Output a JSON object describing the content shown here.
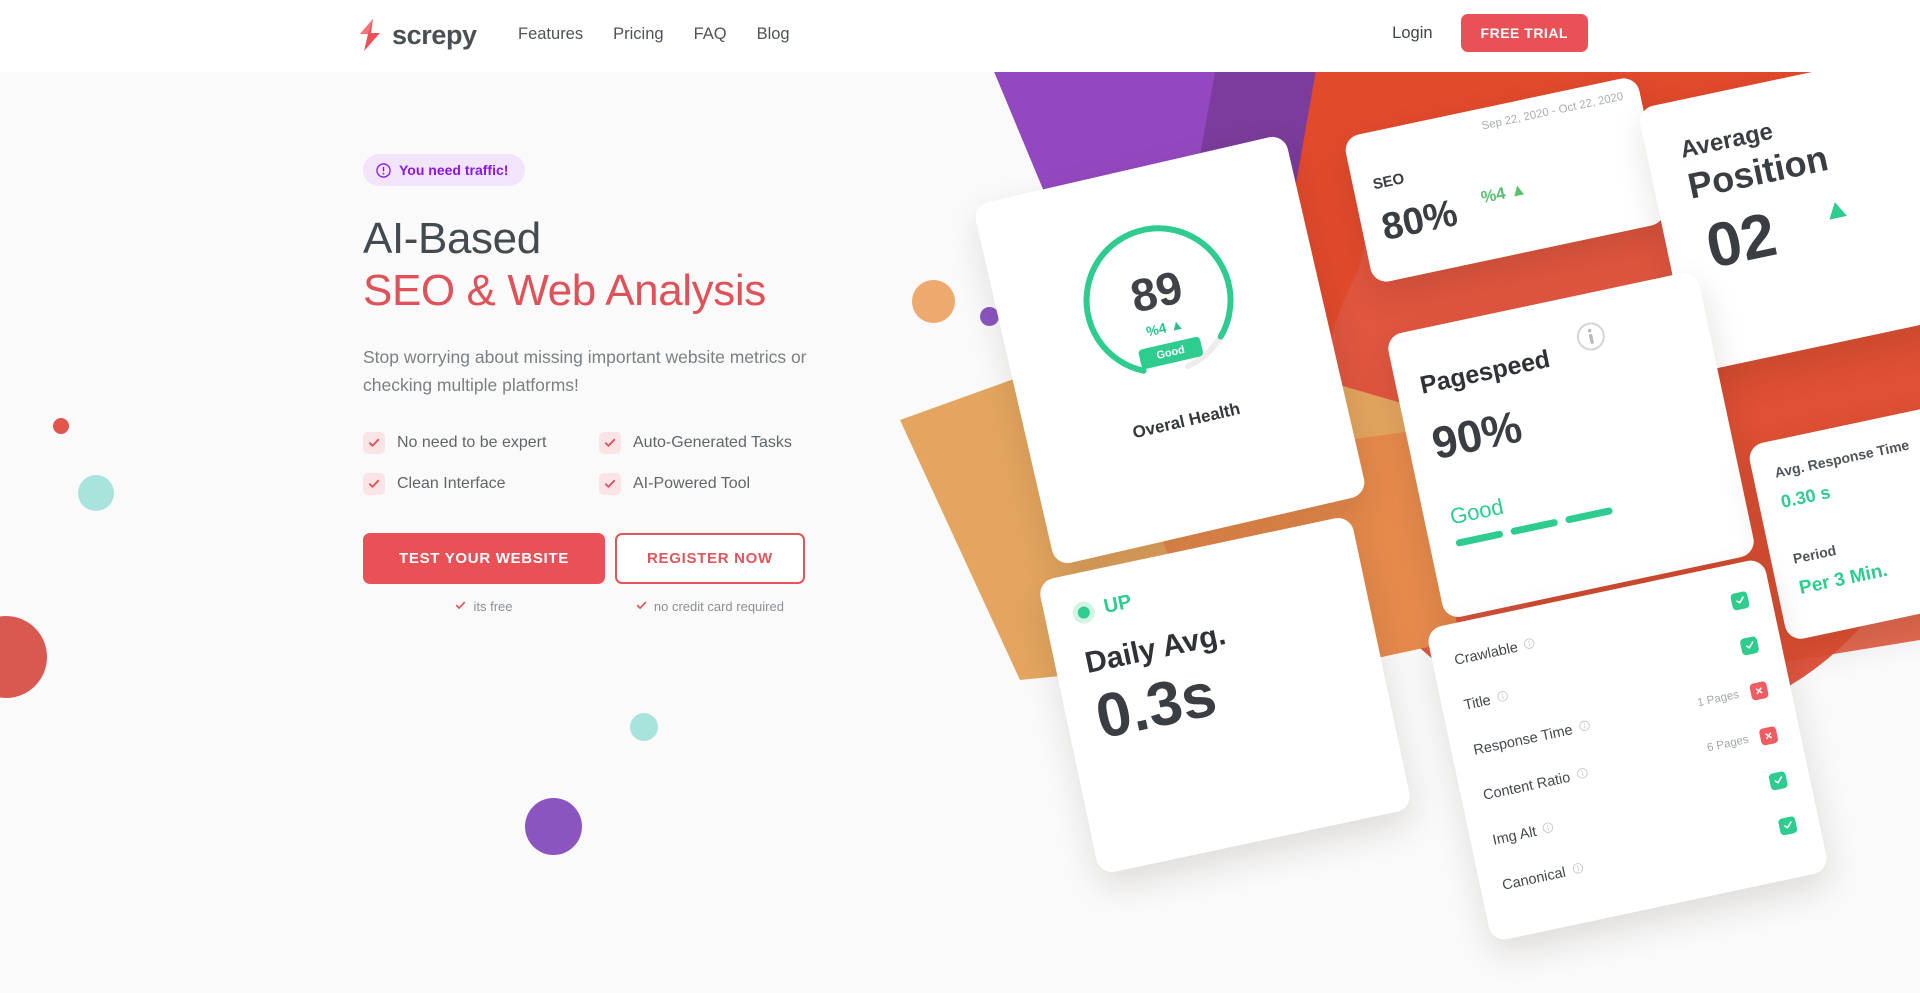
{
  "header": {
    "brand": "screpy",
    "nav": [
      {
        "label": "Features"
      },
      {
        "label": "Pricing"
      },
      {
        "label": "FAQ"
      },
      {
        "label": "Blog"
      }
    ],
    "login_label": "Login",
    "free_trial_label": "FREE TRIAL"
  },
  "hero": {
    "badge": {
      "icon": "alert-circle-icon",
      "text": "You need traffic!"
    },
    "headline_line1": "AI-Based",
    "headline_line2": "SEO & Web Analysis",
    "subtext": "Stop worrying about missing important website metrics or checking multiple platforms!",
    "features": [
      {
        "label": "No need to be expert"
      },
      {
        "label": "Auto-Generated Tasks"
      },
      {
        "label": "Clean Interface"
      },
      {
        "label": "AI-Powered Tool"
      }
    ],
    "primary_cta": "TEST YOUR WEBSITE",
    "primary_note": "its free",
    "secondary_cta": "REGISTER NOW",
    "secondary_note": "no credit card required"
  },
  "cards": {
    "health": {
      "value": "89",
      "delta": "%4 ▲",
      "status": "Good",
      "label": "Overal Health",
      "gauge_percent": 89
    },
    "seo": {
      "date_range": "Sep 22, 2020 - Oct 22, 2020",
      "title": "SEO",
      "value": "80%",
      "delta": "%4 ▲"
    },
    "position": {
      "title_line1": "Average",
      "title_line2": "Position",
      "value": "02"
    },
    "pagespeed": {
      "title": "Pagespeed",
      "info_icon": "info-icon",
      "value": "90%",
      "status": "Good",
      "bars": 3
    },
    "response": {
      "label1": "Avg. Response Time",
      "value1": "0.30 s",
      "label2": "Period",
      "value2": "Per 3 Min."
    },
    "daily": {
      "status": "UP",
      "title": "Daily Avg.",
      "value": "0.3s"
    },
    "checklist": {
      "rows": [
        {
          "name": "Crawlable",
          "pages": "",
          "state": "ok"
        },
        {
          "name": "Title",
          "pages": "",
          "state": "ok"
        },
        {
          "name": "Response Time",
          "pages": "1 Pages",
          "state": "fail"
        },
        {
          "name": "Content Ratio",
          "pages": "6 Pages",
          "state": "fail"
        },
        {
          "name": "Img Alt",
          "pages": "",
          "state": "ok"
        },
        {
          "name": "Canonical",
          "pages": "",
          "state": "ok"
        }
      ]
    }
  },
  "colors": {
    "brand_red": "#ea5157",
    "accent_red": "#e05259",
    "green": "#2ecc8f",
    "purple": "#8a18e0",
    "badge_bg": "#f2e4fb",
    "hero_bg": "#fafafa",
    "decor_orange": "#eda96e",
    "decor_purple": "#8b55c0",
    "decor_mint": "#a8e4dc",
    "decor_red": "#d9584f"
  }
}
